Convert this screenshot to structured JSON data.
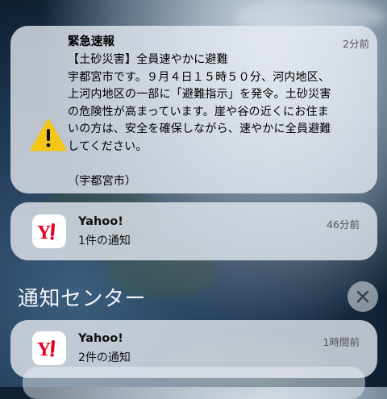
{
  "emergency_alert": {
    "title": "緊急速報",
    "time": "2分前",
    "body": "【土砂災害】全員速やかに避難\n宇都宮市です。９月４日１５時５０分、河内地区、\n上河内地区の一部に「避難指示」を発令。土砂災害\nの危険性が高まっています。崖や谷の近くにお住ま\nいの方は、安全を確保しながら、速やかに全員避難\nしてください。\n\n（宇都宮市）",
    "icon": "warning-triangle-icon"
  },
  "notifications": [
    {
      "app": "Yahoo!",
      "message": "1件の通知",
      "time": "46分前",
      "icon": "yahoo-app-icon"
    },
    {
      "app": "Yahoo!",
      "message": "2件の通知",
      "time": "1時間前",
      "icon": "yahoo-app-icon"
    }
  ],
  "notification_center": {
    "title": "通知センター",
    "clear_icon": "close-icon"
  },
  "colors": {
    "warning_yellow": "#F5C518",
    "yahoo_red": "#E60023"
  }
}
